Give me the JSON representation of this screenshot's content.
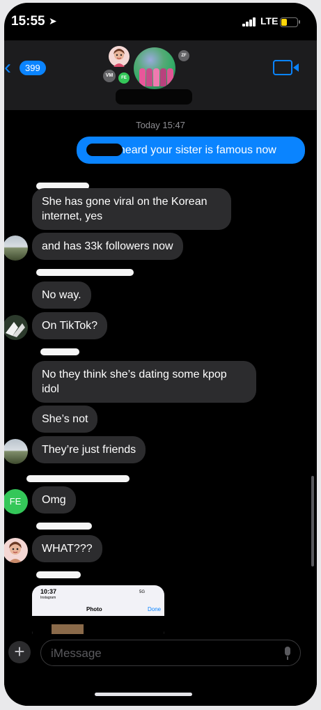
{
  "status_bar": {
    "time": "15:55",
    "network": "LTE"
  },
  "header": {
    "back_count": "399",
    "member_initials": {
      "top_right": "ZF",
      "left": "VM",
      "mid": "FE"
    }
  },
  "chat": {
    "timestamp": "Today 15:47",
    "messages": [
      {
        "direction": "outgoing",
        "text": "I heard your sister is famous now"
      },
      {
        "direction": "incoming",
        "text": "She has gone viral on the Korean internet, yes"
      },
      {
        "direction": "incoming",
        "text": "and has 33k followers now"
      },
      {
        "direction": "incoming",
        "text": "No way."
      },
      {
        "direction": "incoming",
        "text": "On TikTok?"
      },
      {
        "direction": "incoming",
        "text": "No they think she’s dating some kpop idol"
      },
      {
        "direction": "incoming",
        "text": "She’s not"
      },
      {
        "direction": "incoming",
        "text": "They’re just friends"
      },
      {
        "direction": "incoming",
        "text": "Omg"
      },
      {
        "direction": "incoming",
        "text": "WHAT???"
      }
    ],
    "avatar_initials_fe": "FE",
    "attachment": {
      "time": "10:37",
      "app": "Instagram",
      "network": "5G",
      "title": "Photo",
      "done_label": "Done"
    }
  },
  "compose": {
    "placeholder": "iMessage"
  },
  "colors": {
    "accent": "#0a84ff",
    "incoming_bubble": "#2c2c2e",
    "background": "#000000"
  }
}
